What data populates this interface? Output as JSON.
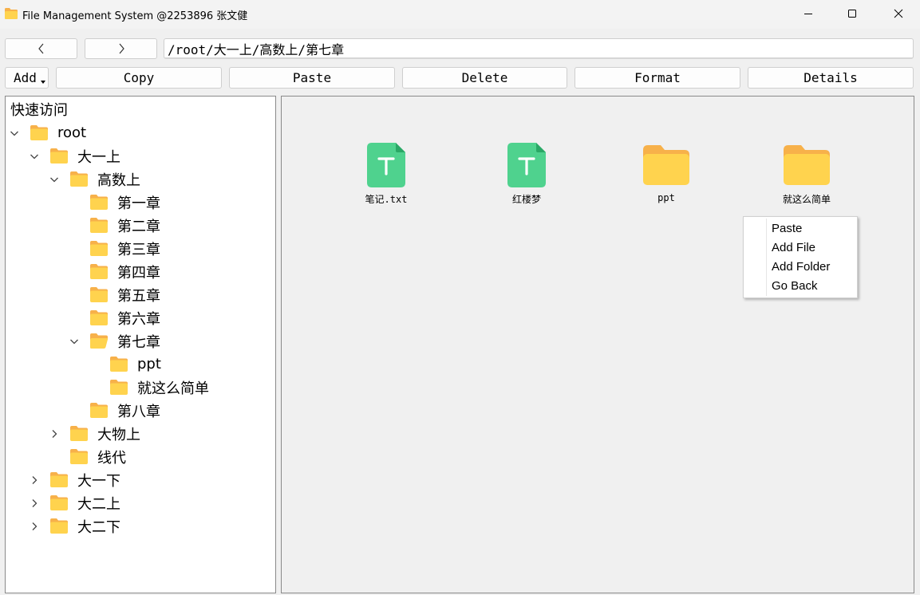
{
  "window": {
    "title": "File Management System @2253896 张文健",
    "icon": "folder-icon"
  },
  "nav": {
    "back_icon": "chevron-left-icon",
    "forward_icon": "chevron-right-icon",
    "path": "/root/大一上/高数上/第七章"
  },
  "toolbar": {
    "add_label": "Add",
    "copy_label": "Copy",
    "paste_label": "Paste",
    "delete_label": "Delete",
    "format_label": "Format",
    "details_label": "Details"
  },
  "tree": {
    "header": "快速访问",
    "items": [
      {
        "label": "root",
        "depth": 0,
        "chevron": "down"
      },
      {
        "label": "大一上",
        "depth": 1,
        "chevron": "down"
      },
      {
        "label": "高数上",
        "depth": 2,
        "chevron": "down"
      },
      {
        "label": "第一章",
        "depth": 3,
        "chevron": "none"
      },
      {
        "label": "第二章",
        "depth": 3,
        "chevron": "none"
      },
      {
        "label": "第三章",
        "depth": 3,
        "chevron": "none"
      },
      {
        "label": "第四章",
        "depth": 3,
        "chevron": "none"
      },
      {
        "label": "第五章",
        "depth": 3,
        "chevron": "none"
      },
      {
        "label": "第六章",
        "depth": 3,
        "chevron": "none"
      },
      {
        "label": "第七章",
        "depth": 3,
        "chevron": "down",
        "open": true
      },
      {
        "label": "ppt",
        "depth": 4,
        "chevron": "none"
      },
      {
        "label": "就这么简单",
        "depth": 4,
        "chevron": "none"
      },
      {
        "label": "第八章",
        "depth": 3,
        "chevron": "none"
      },
      {
        "label": "大物上",
        "depth": 2,
        "chevron": "right"
      },
      {
        "label": "线代",
        "depth": 2,
        "chevron": "none"
      },
      {
        "label": "大一下",
        "depth": 1,
        "chevron": "right"
      },
      {
        "label": "大二上",
        "depth": 1,
        "chevron": "right"
      },
      {
        "label": "大二下",
        "depth": 1,
        "chevron": "right"
      }
    ]
  },
  "files": [
    {
      "name": "笔记.txt",
      "type": "text-file-icon"
    },
    {
      "name": "红楼梦",
      "type": "text-file-icon"
    },
    {
      "name": "ppt",
      "type": "folder-icon"
    },
    {
      "name": "就这么简单",
      "type": "folder-icon"
    }
  ],
  "context_menu": {
    "items": [
      "Paste",
      "Add File",
      "Add Folder",
      "Go Back"
    ]
  },
  "colors": {
    "folder": "#ffd34e",
    "folder_tab": "#f7b14a",
    "text_file": "#4fd28e",
    "text_file_corner": "#2aa866"
  }
}
